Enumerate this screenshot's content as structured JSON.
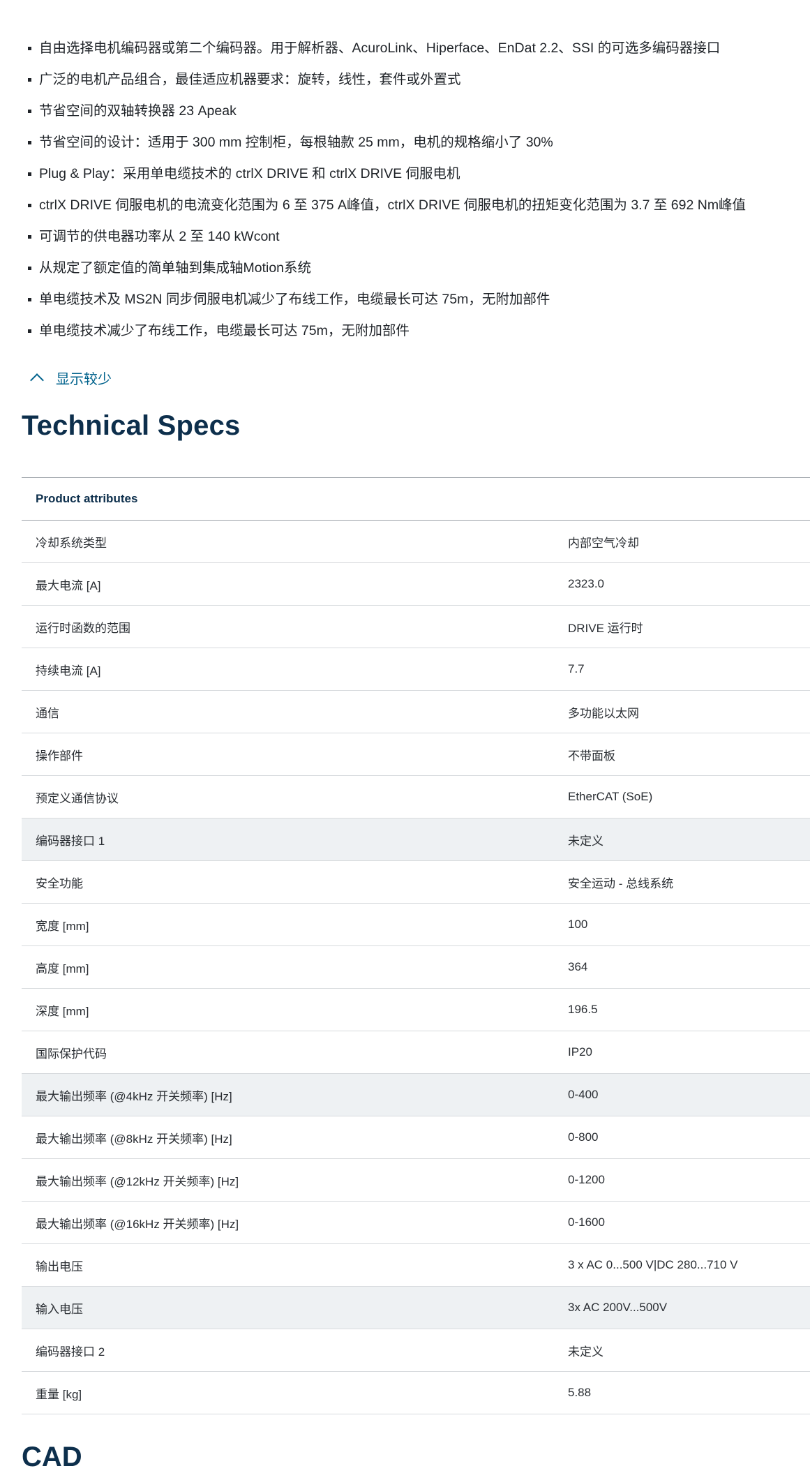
{
  "features": [
    "自由选择电机编码器或第二个编码器。用于解析器、AcuroLink、Hiperface、EnDat 2.2、SSI 的可选多编码器接口",
    "广泛的电机产品组合，最佳适应机器要求：旋转，线性，套件或外置式",
    "节省空间的双轴转换器 23 Apeak",
    "节省空间的设计：适用于 300 mm 控制柜，每根轴款 25 mm，电机的规格缩小了 30%",
    "Plug & Play：采用单电缆技术的 ctrlX DRIVE 和 ctrlX DRIVE 伺服电机",
    "ctrlX DRIVE 伺服电机的电流变化范围为 6 至 375 A峰值，ctrlX DRIVE 伺服电机的扭矩变化范围为 3.7 至 692 Nm峰值",
    "可调节的供电器功率从 2 至 140 kWcont",
    "从规定了额定值的简单轴到集成轴Motion系统",
    "单电缆技术及 MS2N 同步伺服电机减少了布线工作，电缆最长可达 75m，无附加部件",
    "单电缆技术减少了布线工作，电缆最长可达 75m，无附加部件"
  ],
  "toggle": {
    "label": "显示较少",
    "icon": "chevron-up-icon"
  },
  "specs": {
    "title": "Technical Specs",
    "header": "Product attributes",
    "rows": [
      {
        "label": "冷却系统类型",
        "value": "内部空气冷却",
        "highlighted": false
      },
      {
        "label": "最大电流 [A]",
        "value": "2323.0",
        "highlighted": false
      },
      {
        "label": "运行时函数的范围",
        "value": "DRIVE 运行时",
        "highlighted": false
      },
      {
        "label": "持续电流 [A]",
        "value": "7.7",
        "highlighted": false
      },
      {
        "label": "通信",
        "value": "多功能以太网",
        "highlighted": false
      },
      {
        "label": "操作部件",
        "value": "不带面板",
        "highlighted": false
      },
      {
        "label": "预定义通信协议",
        "value": "EtherCAT (SoE)",
        "highlighted": false
      },
      {
        "label": "编码器接口 1",
        "value": "未定义",
        "highlighted": true
      },
      {
        "label": "安全功能",
        "value": "安全运动 - 总线系统",
        "highlighted": false
      },
      {
        "label": "宽度 [mm]",
        "value": "100",
        "highlighted": false
      },
      {
        "label": "高度 [mm]",
        "value": "364",
        "highlighted": false
      },
      {
        "label": "深度 [mm]",
        "value": "196.5",
        "highlighted": false
      },
      {
        "label": "国际保护代码",
        "value": "IP20",
        "highlighted": false
      },
      {
        "label": "最大输出频率 (@4kHz 开关频率) [Hz]",
        "value": "0-400",
        "highlighted": true
      },
      {
        "label": "最大输出频率 (@8kHz 开关频率) [Hz]",
        "value": "0-800",
        "highlighted": false
      },
      {
        "label": "最大输出频率 (@12kHz 开关频率) [Hz]",
        "value": "0-1200",
        "highlighted": false
      },
      {
        "label": "最大输出频率 (@16kHz 开关频率) [Hz]",
        "value": "0-1600",
        "highlighted": false
      },
      {
        "label": "输出电压",
        "value": "3 x AC 0...500 V|DC 280...710 V",
        "highlighted": false
      },
      {
        "label": "输入电压",
        "value": "3x AC 200V...500V",
        "highlighted": true
      },
      {
        "label": "编码器接口 2",
        "value": "未定义",
        "highlighted": false
      },
      {
        "label": "重量 [kg]",
        "value": "5.88",
        "highlighted": false
      }
    ]
  },
  "next_section": {
    "title": "CAD"
  },
  "colors": {
    "heading": "#0d2f4c",
    "link": "#00628c",
    "row_highlight": "#eef1f3"
  }
}
